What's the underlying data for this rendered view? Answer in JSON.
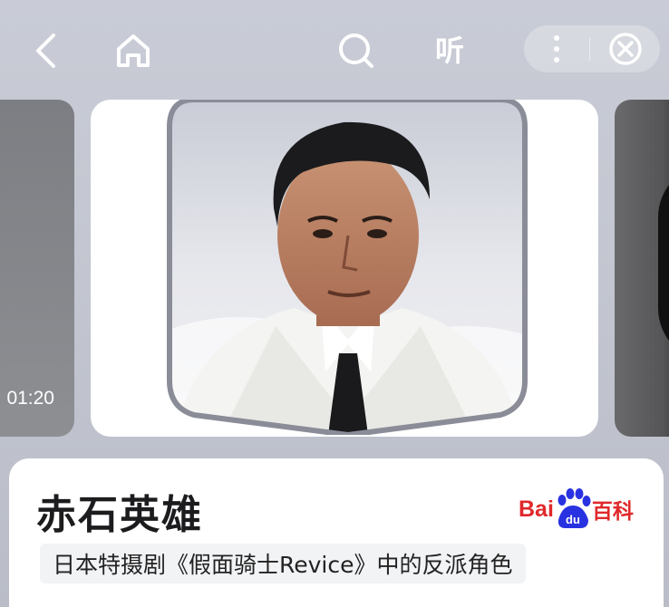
{
  "topbar": {
    "listen_label": "听"
  },
  "icons": {
    "back": "chevron-left-icon",
    "home": "home-icon",
    "search": "search-icon",
    "more": "more-vertical-icon",
    "close": "close-circle-icon"
  },
  "carousel": {
    "left_card_time": "01:20"
  },
  "info": {
    "name": "赤石英雄",
    "description": "日本特摄剧《假面骑士Revice》中的反派角色",
    "brand": {
      "bai": "Bai",
      "du": "du",
      "baike": "百科"
    }
  },
  "colors": {
    "brand_red": "#e0282a",
    "brand_blue": "#2932e1"
  }
}
